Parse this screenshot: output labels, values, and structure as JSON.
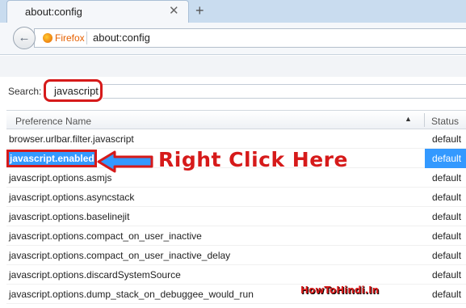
{
  "tab": {
    "title": "about:config",
    "close_glyph": "✕",
    "new_tab_glyph": "+"
  },
  "navbar": {
    "back_glyph": "←",
    "identity_label": "Firefox",
    "url": "about:config"
  },
  "search": {
    "label": "Search:",
    "value": "javascript"
  },
  "table": {
    "columns": {
      "name": "Preference Name",
      "status": "Status"
    },
    "rows": [
      {
        "name": "browser.urlbar.filter.javascript",
        "status": "default"
      },
      {
        "name": "javascript.enabled",
        "status": "default"
      },
      {
        "name": "javascript.options.asmjs",
        "status": "default"
      },
      {
        "name": "javascript.options.asyncstack",
        "status": "default"
      },
      {
        "name": "javascript.options.baselinejit",
        "status": "default"
      },
      {
        "name": "javascript.options.compact_on_user_inactive",
        "status": "default"
      },
      {
        "name": "javascript.options.compact_on_user_inactive_delay",
        "status": "default"
      },
      {
        "name": "javascript.options.discardSystemSource",
        "status": "default"
      },
      {
        "name": "javascript.options.dump_stack_on_debuggee_would_run",
        "status": "default"
      }
    ],
    "selected_row": "javascript.enabled"
  },
  "annotation": {
    "text": "Right Click Here",
    "color": "#d61a1a"
  },
  "watermark": "HowToHindi.In",
  "colors": {
    "selection": "#3399ff",
    "highlight_red": "#d61a1a",
    "firefox_orange": "#e66000"
  }
}
